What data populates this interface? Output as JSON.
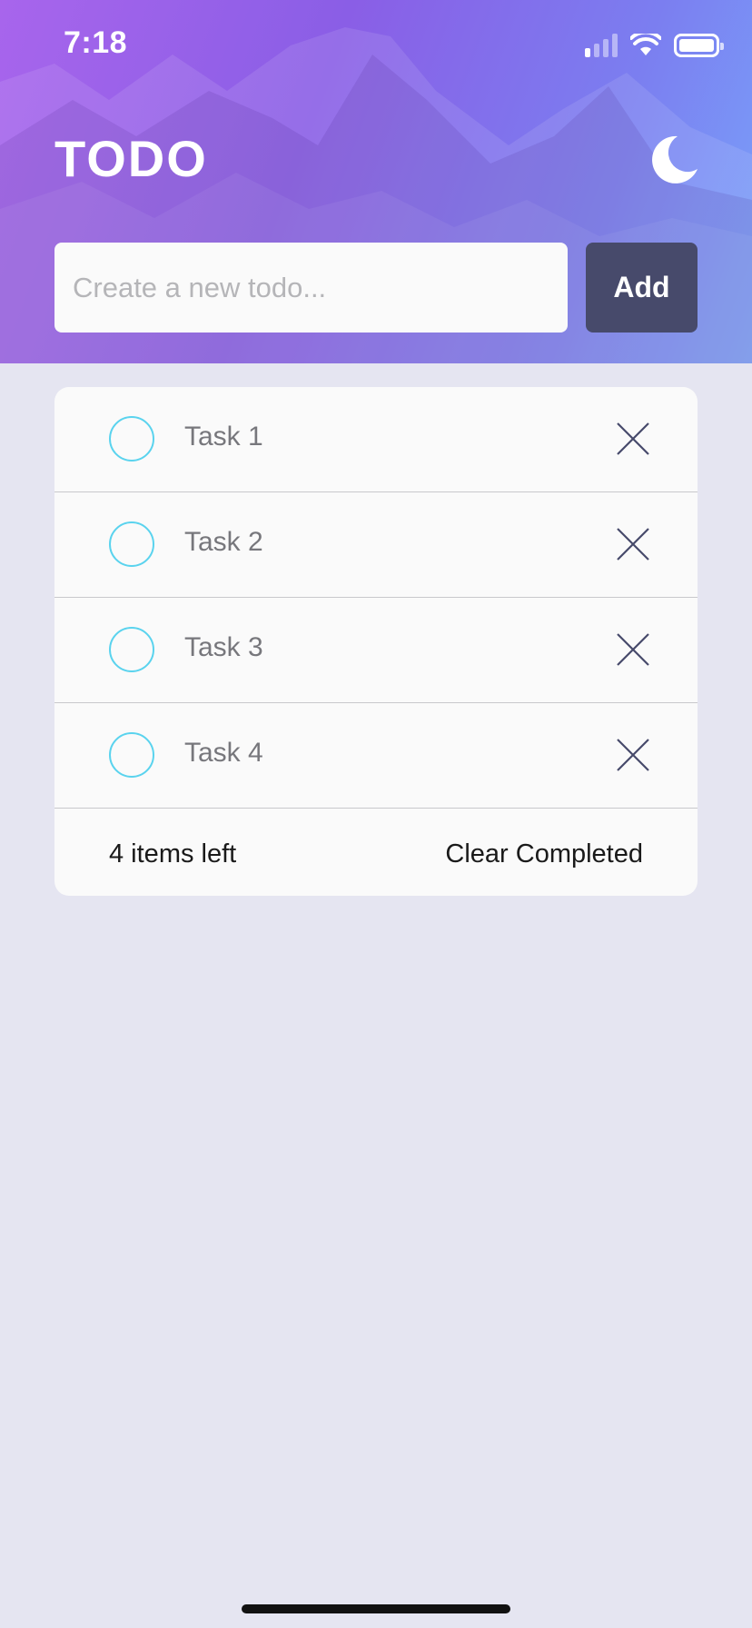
{
  "status_bar": {
    "time": "7:18"
  },
  "header": {
    "title": "TODO"
  },
  "new_todo": {
    "placeholder": "Create a new todo...",
    "value": "",
    "add_label": "Add"
  },
  "todos": [
    {
      "label": "Task 1",
      "completed": false
    },
    {
      "label": "Task 2",
      "completed": false
    },
    {
      "label": "Task 3",
      "completed": false
    },
    {
      "label": "Task 4",
      "completed": false
    }
  ],
  "footer": {
    "items_left": "4 items left",
    "clear_label": "Clear Completed"
  },
  "icons": {
    "theme_toggle": "moon-icon",
    "checkbox": "circle-checkbox-icon",
    "delete": "close-icon",
    "signal": "cellular-signal-icon",
    "wifi": "wifi-icon",
    "battery": "battery-icon"
  },
  "colors": {
    "accent_check": "#5ad3ee",
    "add_button": "#474a6b",
    "background": "#e5e5f1",
    "card": "#fafafa",
    "delete_icon": "#474a6b"
  }
}
